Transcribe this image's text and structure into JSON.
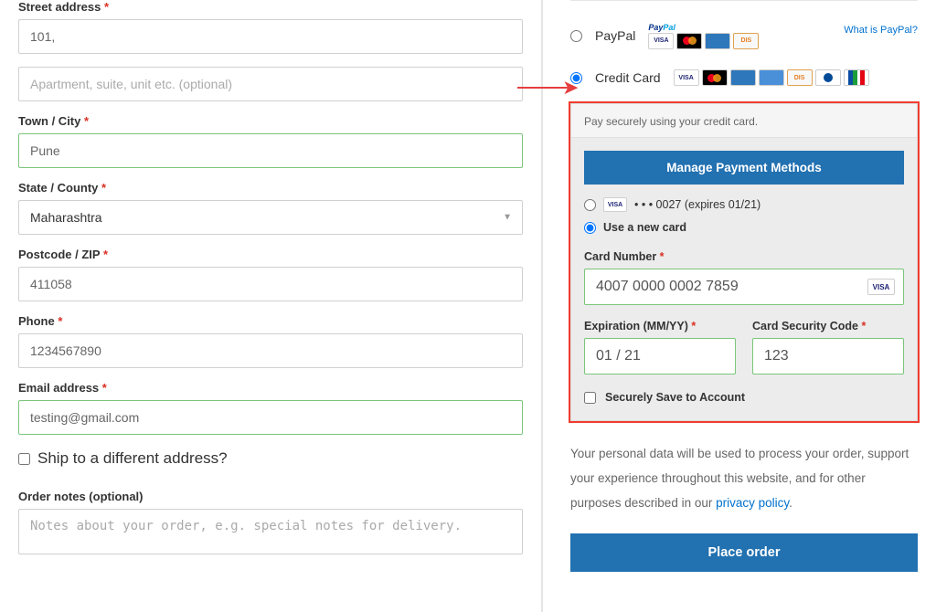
{
  "billing": {
    "street_label": "Street address",
    "street1_value": "101,",
    "street2_placeholder": "Apartment, suite, unit etc. (optional)",
    "town_label": "Town / City",
    "town_value": "Pune",
    "state_label": "State / County",
    "state_value": "Maharashtra",
    "zip_label": "Postcode / ZIP",
    "zip_value": "411058",
    "phone_label": "Phone",
    "phone_value": "1234567890",
    "email_label": "Email address",
    "email_value": "testing@gmail.com",
    "ship_different_label": "Ship to a different address?",
    "order_notes_label": "Order notes (optional)",
    "order_notes_placeholder": "Notes about your order, e.g. special notes for delivery."
  },
  "payment": {
    "paypal_label": "PayPal",
    "what_is_paypal": "What is PayPal?",
    "credit_card_label": "Credit Card",
    "cc_desc": "Pay securely using your credit card.",
    "manage_btn": "Manage Payment Methods",
    "saved_card_text": "• • • 0027 (expires 01/21)",
    "use_new_card": "Use a new card",
    "card_number_label": "Card Number",
    "card_number_value": "4007 0000 0002 7859",
    "expiration_label": "Expiration (MM/YY)",
    "expiration_value": "01 / 21",
    "cvc_label": "Card Security Code",
    "cvc_value": "123",
    "save_label": "Securely Save to Account",
    "card_brand": "VISA"
  },
  "privacy_text_1": "Your personal data will be used to process your order, support your experience throughout this website, and for other purposes described in our ",
  "privacy_link": "privacy policy",
  "place_order": "Place order"
}
